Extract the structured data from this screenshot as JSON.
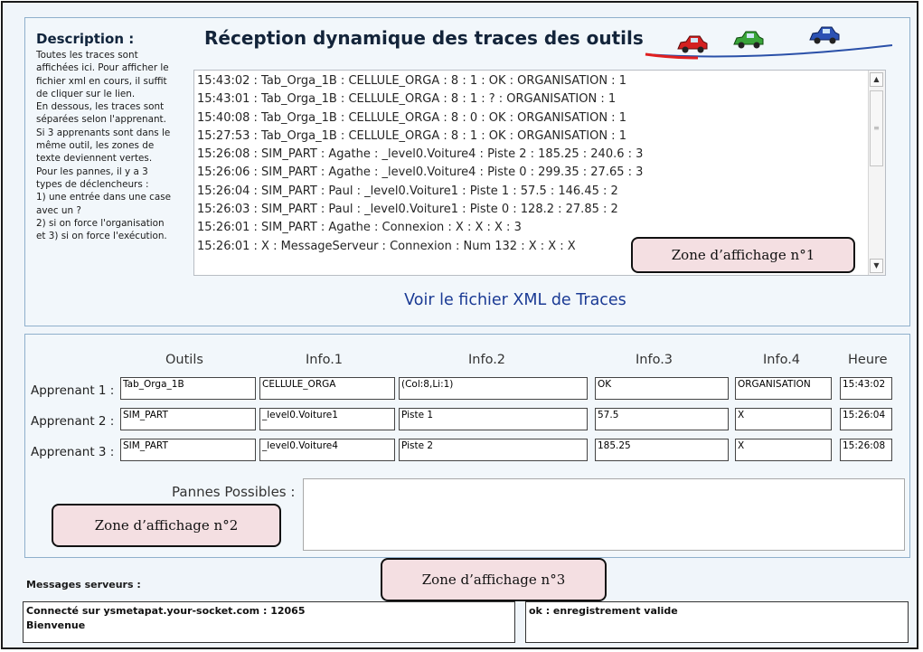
{
  "description": {
    "title": "Description :",
    "text": "Toutes les traces sont\naffichées ici. Pour afficher le\nfichier xml en cours, il suffit\nde cliquer sur le lien.\nEn dessous, les traces sont\nséparées selon l'apprenant.\nSi 3 apprenants sont dans le\nmême outil, les zones de\ntexte deviennent vertes.\nPour les pannes, il y a 3\ntypes de déclencheurs :\n1) une entrée dans une case\navec un ?\n2) si on force l'organisation\net 3) si on force l'exécution."
  },
  "main_title": "Réception dynamique des traces des outils",
  "traces": [
    "15:43:02 : Tab_Orga_1B : CELLULE_ORGA : 8 : 1 : OK : ORGANISATION : 1",
    "15:43:01 : Tab_Orga_1B : CELLULE_ORGA : 8 : 1 : ? : ORGANISATION : 1",
    "15:40:08 : Tab_Orga_1B : CELLULE_ORGA : 8 : 0 : OK : ORGANISATION : 1",
    "15:27:53 : Tab_Orga_1B : CELLULE_ORGA : 8 : 1 : OK : ORGANISATION : 1",
    "15:26:08 : SIM_PART : Agathe : _level0.Voiture4 : Piste 2 : 185.25 : 240.6 : 3",
    "15:26:06 : SIM_PART : Agathe : _level0.Voiture4 : Piste 0 : 299.35 : 27.65 : 3",
    "15:26:04 : SIM_PART : Paul : _level0.Voiture1 : Piste 1 : 57.5 : 146.45 : 2",
    "15:26:03 : SIM_PART : Paul : _level0.Voiture1 : Piste 0 : 128.2 : 27.85 : 2",
    "15:26:01 : SIM_PART : Agathe : Connexion : X : X : X : 3",
    "15:26:01 : X : MessageServeur : Connexion : Num 132 : X : X : X"
  ],
  "scrollbar": {
    "up_arrow": "▲",
    "down_arrow": "▼",
    "grip": "≡"
  },
  "xml_link": "Voir le fichier XML de Traces",
  "callouts": {
    "zone1": "Zone d’affichage n°1",
    "zone2": "Zone d’affichage n°2",
    "zone3": "Zone d’affichage n°3"
  },
  "table": {
    "headers": [
      "Outils",
      "Info.1",
      "Info.2",
      "Info.3",
      "Info.4",
      "Heure"
    ],
    "rows": [
      {
        "label": "Apprenant 1 :",
        "cells": [
          "Tab_Orga_1B",
          "CELLULE_ORGA",
          "(Col:8,Li:1)",
          "OK",
          "ORGANISATION",
          "15:43:02"
        ]
      },
      {
        "label": "Apprenant 2 :",
        "cells": [
          "SIM_PART",
          "_level0.Voiture1",
          "Piste 1",
          "57.5",
          "X",
          "15:26:04"
        ]
      },
      {
        "label": "Apprenant 3 :",
        "cells": [
          "SIM_PART",
          "_level0.Voiture4",
          "Piste 2",
          "185.25",
          "X",
          "15:26:08"
        ]
      }
    ]
  },
  "pannes": {
    "label": "Pannes Possibles :",
    "value": ""
  },
  "messages": {
    "label": "Messages serveurs :",
    "left": "Connecté sur ysmetapat.your-socket.com : 12065\nBienvenue",
    "right": "ok : enregistrement valide"
  },
  "colors": {
    "car_red": "#d42020",
    "car_green": "#3aa43a",
    "car_blue": "#2c52b4",
    "road": "#2a50a8",
    "road_accent": "#e02020",
    "link": "#1a3a94",
    "callout_fill": "#f4dfe2"
  }
}
